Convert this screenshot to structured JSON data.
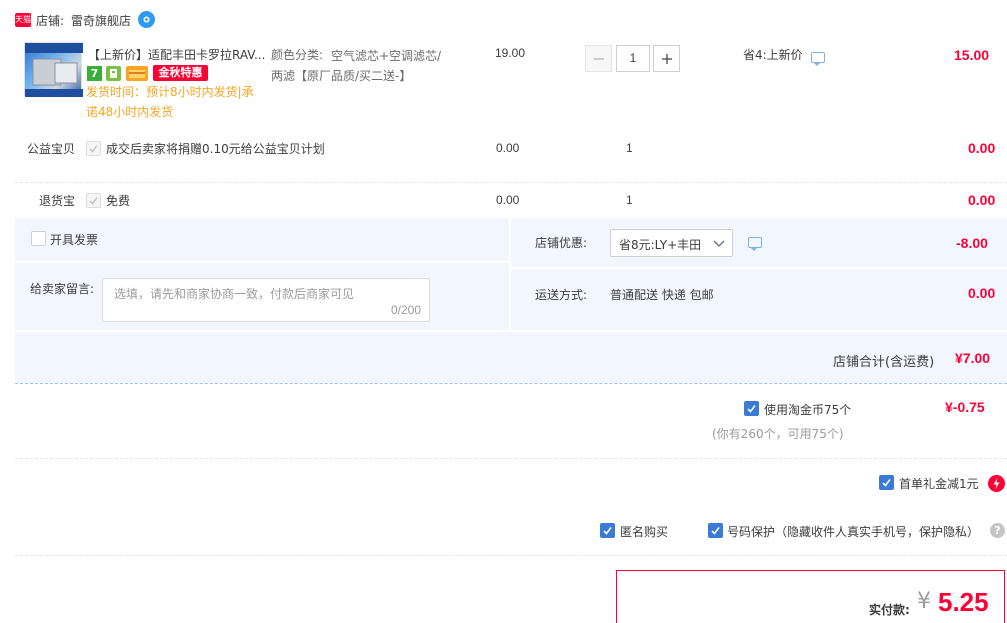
{
  "shop": {
    "prefix": "店铺:",
    "name": "雷奇旗舰店",
    "tmall_badge": "天猫"
  },
  "item": {
    "title": "【上新价】适配丰田卡罗拉RAV...",
    "badges": {
      "seven": "7",
      "promo": "金秋特惠"
    },
    "shipping_note": "发货时间：预计8小时内发货|承诺48小时内发货",
    "spec_label": "颜色分类:",
    "spec_value": "空气滤芯+空调滤芯/两滤【原厂品质/买二送-】",
    "price": "19.00",
    "quantity": "1",
    "discount": "省4:上新价",
    "subtotal": "15.00"
  },
  "charity": {
    "label": "公益宝贝",
    "text": "成交后卖家将捐赠0.10元给公益宝贝计划",
    "price": "0.00",
    "qty": "1",
    "subtotal": "0.00"
  },
  "returns": {
    "label": "退货宝",
    "text": "免费",
    "price": "0.00",
    "qty": "1",
    "subtotal": "0.00"
  },
  "invoice": {
    "label": "开具发票"
  },
  "message": {
    "label": "给卖家留言:",
    "placeholder": "选填，请先和商家协商一致，付款后商家可见",
    "counter": "0/200"
  },
  "store_discount": {
    "label": "店铺优惠:",
    "selected": "省8元:LY+丰田",
    "amount": "-8.00"
  },
  "delivery": {
    "label": "运送方式:",
    "value": "普通配送 快递 包邮",
    "amount": "0.00"
  },
  "store_total": {
    "label": "店铺合计(含运费)",
    "value": "¥7.00"
  },
  "coins": {
    "label": "使用淘金币75个",
    "note": "(你有260个，可用75个)",
    "amount": "¥-0.75"
  },
  "first_order": {
    "label": "首单礼金减1元"
  },
  "anonymous": {
    "label": "匿名购买"
  },
  "privacy": {
    "label": "号码保护（隐藏收件人真实手机号，保护隐私）"
  },
  "pay": {
    "label": "实付款:",
    "currency": "¥",
    "amount": "5.25"
  },
  "colors": {
    "accent": "#ff0036",
    "blue": "#3a7bd5",
    "panel": "#f2f7ff"
  }
}
